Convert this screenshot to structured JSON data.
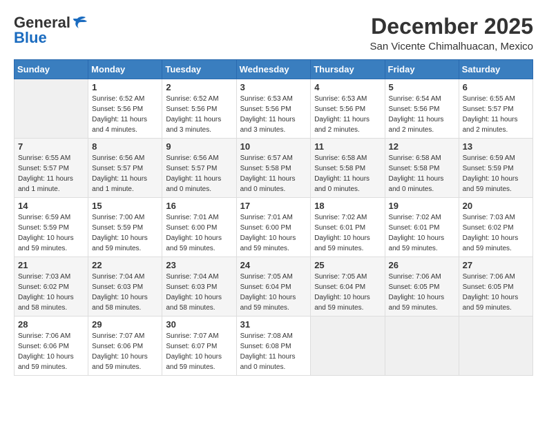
{
  "header": {
    "logo_general": "General",
    "logo_blue": "Blue",
    "month_year": "December 2025",
    "location": "San Vicente Chimalhuacan, Mexico"
  },
  "weekdays": [
    "Sunday",
    "Monday",
    "Tuesday",
    "Wednesday",
    "Thursday",
    "Friday",
    "Saturday"
  ],
  "weeks": [
    [
      {
        "day": "",
        "sunrise": "",
        "sunset": "",
        "daylight": ""
      },
      {
        "day": "1",
        "sunrise": "Sunrise: 6:52 AM",
        "sunset": "Sunset: 5:56 PM",
        "daylight": "Daylight: 11 hours and 4 minutes."
      },
      {
        "day": "2",
        "sunrise": "Sunrise: 6:52 AM",
        "sunset": "Sunset: 5:56 PM",
        "daylight": "Daylight: 11 hours and 3 minutes."
      },
      {
        "day": "3",
        "sunrise": "Sunrise: 6:53 AM",
        "sunset": "Sunset: 5:56 PM",
        "daylight": "Daylight: 11 hours and 3 minutes."
      },
      {
        "day": "4",
        "sunrise": "Sunrise: 6:53 AM",
        "sunset": "Sunset: 5:56 PM",
        "daylight": "Daylight: 11 hours and 2 minutes."
      },
      {
        "day": "5",
        "sunrise": "Sunrise: 6:54 AM",
        "sunset": "Sunset: 5:56 PM",
        "daylight": "Daylight: 11 hours and 2 minutes."
      },
      {
        "day": "6",
        "sunrise": "Sunrise: 6:55 AM",
        "sunset": "Sunset: 5:57 PM",
        "daylight": "Daylight: 11 hours and 2 minutes."
      }
    ],
    [
      {
        "day": "7",
        "sunrise": "Sunrise: 6:55 AM",
        "sunset": "Sunset: 5:57 PM",
        "daylight": "Daylight: 11 hours and 1 minute."
      },
      {
        "day": "8",
        "sunrise": "Sunrise: 6:56 AM",
        "sunset": "Sunset: 5:57 PM",
        "daylight": "Daylight: 11 hours and 1 minute."
      },
      {
        "day": "9",
        "sunrise": "Sunrise: 6:56 AM",
        "sunset": "Sunset: 5:57 PM",
        "daylight": "Daylight: 11 hours and 0 minutes."
      },
      {
        "day": "10",
        "sunrise": "Sunrise: 6:57 AM",
        "sunset": "Sunset: 5:58 PM",
        "daylight": "Daylight: 11 hours and 0 minutes."
      },
      {
        "day": "11",
        "sunrise": "Sunrise: 6:58 AM",
        "sunset": "Sunset: 5:58 PM",
        "daylight": "Daylight: 11 hours and 0 minutes."
      },
      {
        "day": "12",
        "sunrise": "Sunrise: 6:58 AM",
        "sunset": "Sunset: 5:58 PM",
        "daylight": "Daylight: 11 hours and 0 minutes."
      },
      {
        "day": "13",
        "sunrise": "Sunrise: 6:59 AM",
        "sunset": "Sunset: 5:59 PM",
        "daylight": "Daylight: 10 hours and 59 minutes."
      }
    ],
    [
      {
        "day": "14",
        "sunrise": "Sunrise: 6:59 AM",
        "sunset": "Sunset: 5:59 PM",
        "daylight": "Daylight: 10 hours and 59 minutes."
      },
      {
        "day": "15",
        "sunrise": "Sunrise: 7:00 AM",
        "sunset": "Sunset: 5:59 PM",
        "daylight": "Daylight: 10 hours and 59 minutes."
      },
      {
        "day": "16",
        "sunrise": "Sunrise: 7:01 AM",
        "sunset": "Sunset: 6:00 PM",
        "daylight": "Daylight: 10 hours and 59 minutes."
      },
      {
        "day": "17",
        "sunrise": "Sunrise: 7:01 AM",
        "sunset": "Sunset: 6:00 PM",
        "daylight": "Daylight: 10 hours and 59 minutes."
      },
      {
        "day": "18",
        "sunrise": "Sunrise: 7:02 AM",
        "sunset": "Sunset: 6:01 PM",
        "daylight": "Daylight: 10 hours and 59 minutes."
      },
      {
        "day": "19",
        "sunrise": "Sunrise: 7:02 AM",
        "sunset": "Sunset: 6:01 PM",
        "daylight": "Daylight: 10 hours and 59 minutes."
      },
      {
        "day": "20",
        "sunrise": "Sunrise: 7:03 AM",
        "sunset": "Sunset: 6:02 PM",
        "daylight": "Daylight: 10 hours and 59 minutes."
      }
    ],
    [
      {
        "day": "21",
        "sunrise": "Sunrise: 7:03 AM",
        "sunset": "Sunset: 6:02 PM",
        "daylight": "Daylight: 10 hours and 58 minutes."
      },
      {
        "day": "22",
        "sunrise": "Sunrise: 7:04 AM",
        "sunset": "Sunset: 6:03 PM",
        "daylight": "Daylight: 10 hours and 58 minutes."
      },
      {
        "day": "23",
        "sunrise": "Sunrise: 7:04 AM",
        "sunset": "Sunset: 6:03 PM",
        "daylight": "Daylight: 10 hours and 58 minutes."
      },
      {
        "day": "24",
        "sunrise": "Sunrise: 7:05 AM",
        "sunset": "Sunset: 6:04 PM",
        "daylight": "Daylight: 10 hours and 59 minutes."
      },
      {
        "day": "25",
        "sunrise": "Sunrise: 7:05 AM",
        "sunset": "Sunset: 6:04 PM",
        "daylight": "Daylight: 10 hours and 59 minutes."
      },
      {
        "day": "26",
        "sunrise": "Sunrise: 7:06 AM",
        "sunset": "Sunset: 6:05 PM",
        "daylight": "Daylight: 10 hours and 59 minutes."
      },
      {
        "day": "27",
        "sunrise": "Sunrise: 7:06 AM",
        "sunset": "Sunset: 6:05 PM",
        "daylight": "Daylight: 10 hours and 59 minutes."
      }
    ],
    [
      {
        "day": "28",
        "sunrise": "Sunrise: 7:06 AM",
        "sunset": "Sunset: 6:06 PM",
        "daylight": "Daylight: 10 hours and 59 minutes."
      },
      {
        "day": "29",
        "sunrise": "Sunrise: 7:07 AM",
        "sunset": "Sunset: 6:06 PM",
        "daylight": "Daylight: 10 hours and 59 minutes."
      },
      {
        "day": "30",
        "sunrise": "Sunrise: 7:07 AM",
        "sunset": "Sunset: 6:07 PM",
        "daylight": "Daylight: 10 hours and 59 minutes."
      },
      {
        "day": "31",
        "sunrise": "Sunrise: 7:08 AM",
        "sunset": "Sunset: 6:08 PM",
        "daylight": "Daylight: 11 hours and 0 minutes."
      },
      {
        "day": "",
        "sunrise": "",
        "sunset": "",
        "daylight": ""
      },
      {
        "day": "",
        "sunrise": "",
        "sunset": "",
        "daylight": ""
      },
      {
        "day": "",
        "sunrise": "",
        "sunset": "",
        "daylight": ""
      }
    ]
  ]
}
